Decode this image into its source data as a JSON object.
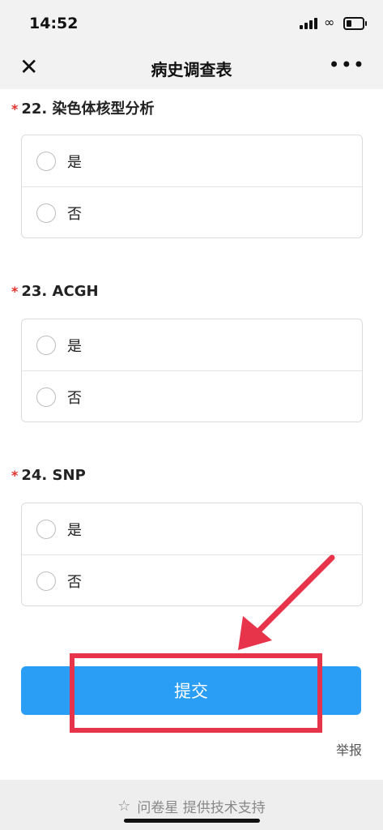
{
  "status_bar": {
    "time": "14:52"
  },
  "nav": {
    "title": "病史调查表",
    "close_icon": "close-icon",
    "more_icon": "more-icon"
  },
  "questions": [
    {
      "number": "22.",
      "title": "染色体核型分析",
      "required": "*",
      "options": [
        "是",
        "否"
      ]
    },
    {
      "number": "23.",
      "title": "ACGH",
      "required": "*",
      "options": [
        "是",
        "否"
      ]
    },
    {
      "number": "24.",
      "title": "SNP",
      "required": "*",
      "options": [
        "是",
        "否"
      ]
    }
  ],
  "submit_label": "提交",
  "report_label": "举报",
  "footer": {
    "text": "问卷星 提供技术支持"
  },
  "colors": {
    "accent": "#2a9df4",
    "annotation": "#e8344a",
    "required": "#e0302a"
  }
}
